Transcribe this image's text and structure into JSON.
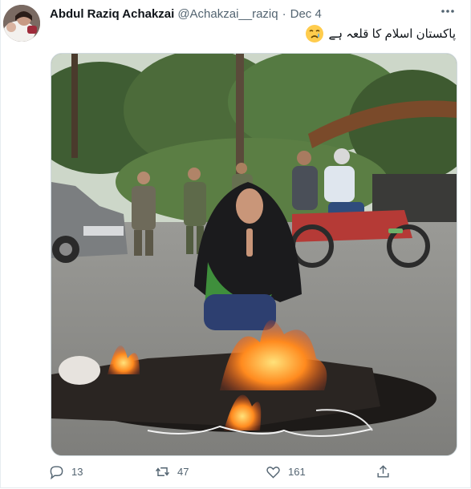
{
  "tweet": {
    "display_name": "Abdul Raziq Achakzai",
    "handle": "@Achakzai__raziq",
    "separator": "·",
    "date": "Dec 4",
    "text": "پاکستان اسلام کا قلعہ ہے",
    "emoji_icon": "crying-face-icon"
  },
  "stats": {
    "replies": "13",
    "retweets": "47",
    "likes": "161"
  },
  "colors": {
    "secondary_text": "#536471",
    "border": "#cfd9de"
  }
}
